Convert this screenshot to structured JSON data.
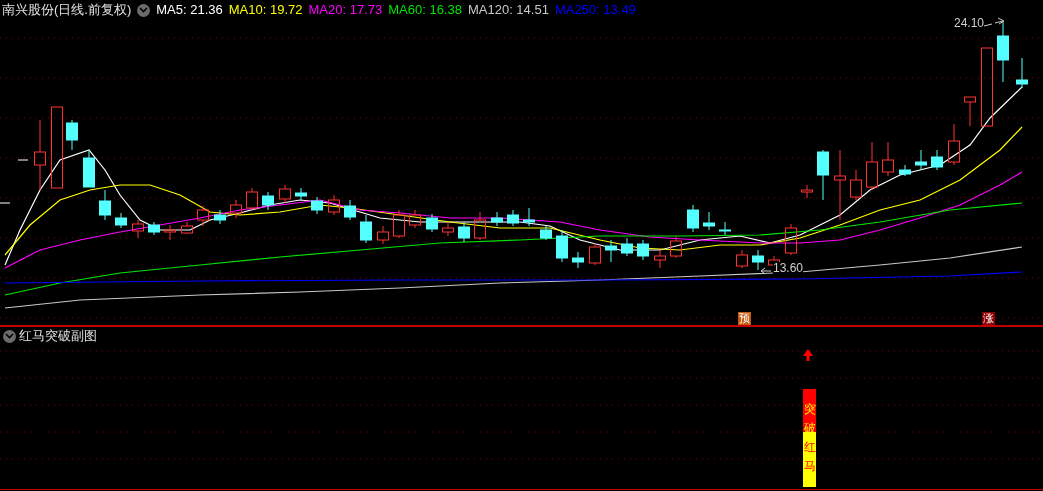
{
  "main_chart": {
    "title": "南兴股份(日线.前复权)",
    "ma_legend": [
      {
        "label": "MA5: 21.36",
        "color": "#ffffff"
      },
      {
        "label": "MA10: 19.72",
        "color": "#ffff00"
      },
      {
        "label": "MA20: 17.73",
        "color": "#ff00ff"
      },
      {
        "label": "MA60: 16.38",
        "color": "#00e600"
      },
      {
        "label": "MA120: 14.51",
        "color": "#c8c8c8"
      },
      {
        "label": "MA250: 13.49",
        "color": "#0000ff"
      }
    ],
    "high_label": "24.10",
    "low_label": "13.60",
    "markers": [
      {
        "text": "预",
        "color": "#c85a10"
      },
      {
        "text": "涨",
        "color": "#8b0000"
      }
    ]
  },
  "sub_chart": {
    "title": "红马突破副图",
    "signal_text": "突破红马"
  }
}
